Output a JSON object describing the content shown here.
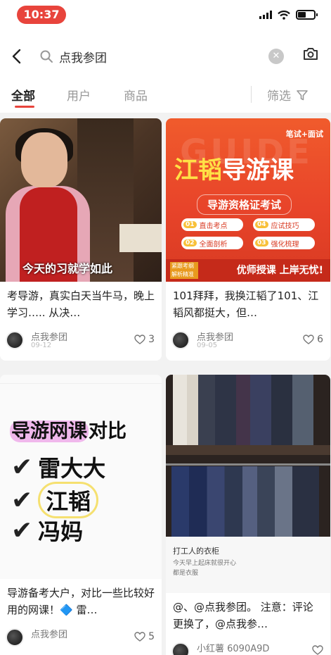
{
  "status_bar": {
    "time": "10:37"
  },
  "search": {
    "query": "点我参团"
  },
  "tabs": [
    {
      "label": "全部",
      "active": true
    },
    {
      "label": "用户",
      "active": false
    },
    {
      "label": "商品",
      "active": false
    }
  ],
  "filter_label": "筛选",
  "accent_color": "#e8443c",
  "cards": [
    {
      "cover_caption": "今天的习就学如此",
      "title": "考导游，真实白天当牛马，晚上学习….. 从决…",
      "author": "点我参团",
      "date": "09-12",
      "likes": "3"
    },
    {
      "cover": {
        "tag": "笔试+面试",
        "watermark": "GUIDE",
        "title_yellow": "江韬",
        "title_white": "导游课",
        "subtitle": "导游资格证考试",
        "features": [
          {
            "num": "01",
            "text": "直击考点"
          },
          {
            "num": "02",
            "text": "全面剖析"
          },
          {
            "num": "03",
            "text": "强化梳理"
          },
          {
            "num": "04",
            "text": "应试技巧"
          }
        ],
        "logo": "紧跟考纲 解析精准",
        "slogan": "优师授课 上岸无忧!"
      },
      "title": "101拜拜，我换江韬了101、江韬风都挺大，但…",
      "author": "点我参团",
      "date": "09-05",
      "likes": "6"
    },
    {
      "cover": {
        "title_highlight": "导游网课",
        "title_rest": "对比",
        "items": [
          "雷大大",
          "江韬",
          "冯妈"
        ]
      },
      "title": "导游备考大户，对比一些比较好用的网课！🔷 雷…",
      "author": "点我参团",
      "likes": "5"
    },
    {
      "cover": {
        "panel_title": "打工人的衣柜",
        "panel_sub": "今天早上起床就很开心",
        "panel_sub2": "都是衣服"
      },
      "title": "@、@点我参团。 注意：评论更换了，@点我参…",
      "author": "小红薯 6090A9D"
    }
  ]
}
